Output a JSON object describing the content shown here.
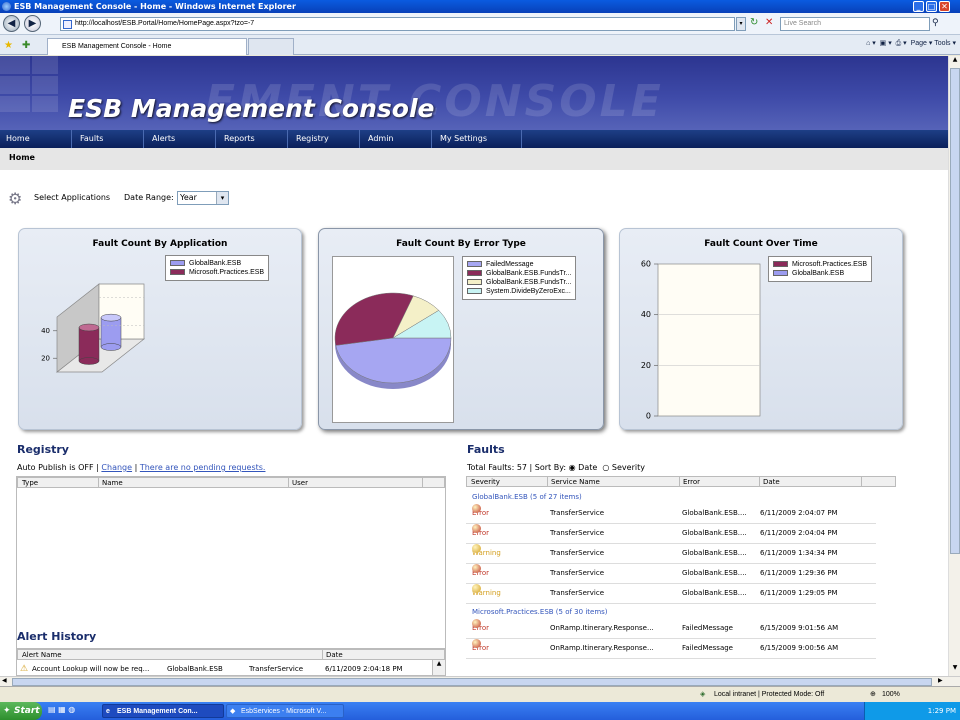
{
  "window": {
    "title": "ESB Management Console - Home - Windows Internet Explorer",
    "url": "http://localhost/ESB.Portal/Home/HomePage.aspx?tzo=-7",
    "search_placeholder": "Live Search",
    "tab_label": "ESB Management Console - Home",
    "commands": "Page ▾  Tools ▾"
  },
  "app": {
    "banner_title": "ESB Management Console",
    "banner_ghost": "EMENT CONSOLE",
    "menu": [
      "Home",
      "Faults",
      "Alerts",
      "Reports",
      "Registry",
      "Admin",
      "My Settings"
    ],
    "breadcrumb": "Home"
  },
  "filter": {
    "select_apps_label": "Select Applications",
    "date_range_label": "Date Range:",
    "date_range_value": "Year"
  },
  "panels": {
    "app": {
      "title": "Fault Count By Application",
      "legend": [
        "GlobalBank.ESB",
        "Microsoft.Practices.ESB"
      ]
    },
    "error": {
      "title": "Fault Count By Error Type",
      "legend": [
        "FailedMessage",
        "GlobalBank.ESB.FundsTr...",
        "GlobalBank.ESB.FundsTr...",
        "System.DivideByZeroExc..."
      ]
    },
    "time": {
      "title": "Fault Count Over Time",
      "legend": [
        "Microsoft.Practices.ESB",
        "GlobalBank.ESB"
      ]
    }
  },
  "chart_data": [
    {
      "type": "bar",
      "title": "Fault Count By Application",
      "categories": [
        ""
      ],
      "series": [
        {
          "name": "Microsoft.Practices.ESB",
          "values": [
            30
          ]
        },
        {
          "name": "GlobalBank.ESB",
          "values": [
            27
          ]
        }
      ],
      "yticks": [
        20,
        40
      ],
      "ylim": [
        10,
        50
      ],
      "colors": [
        "#8b2b5a",
        "#9c9cf0"
      ]
    },
    {
      "type": "pie",
      "title": "Fault Count By Error Type",
      "series": [
        {
          "name": "FailedMessage",
          "values": [
            27
          ]
        },
        {
          "name": "GlobalBank.ESB.FundsTr...",
          "values": [
            19
          ]
        },
        {
          "name": "GlobalBank.ESB.FundsTr...",
          "values": [
            5
          ]
        },
        {
          "name": "System.DivideByZeroExc...",
          "values": [
            6
          ]
        }
      ],
      "colors": [
        "#a6a6f2",
        "#8b2b5a",
        "#f4f0c8",
        "#c8f4f4"
      ]
    },
    {
      "type": "line",
      "title": "Fault Count Over Time",
      "series": [
        {
          "name": "Microsoft.Practices.ESB",
          "values": []
        },
        {
          "name": "GlobalBank.ESB",
          "values": []
        }
      ],
      "yticks": [
        0,
        20,
        40,
        60
      ],
      "ylim": [
        0,
        60
      ],
      "grid": true,
      "colors": [
        "#8b2b5a",
        "#9c9cf0"
      ]
    }
  ],
  "registry": {
    "heading": "Registry",
    "auto_publish": "Auto Publish is OFF |",
    "change_link": "Change",
    "sep": "|",
    "pending_link": "There are no pending requests.",
    "columns": [
      "Type",
      "Name",
      "User"
    ]
  },
  "alert_history": {
    "heading": "Alert History",
    "columns": [
      "Alert Name",
      "Date"
    ],
    "rows": [
      {
        "name": "Account Lookup will now be req...",
        "app": "GlobalBank.ESB",
        "service": "TransferService",
        "date": "6/11/2009 2:04:18 PM"
      }
    ]
  },
  "faults": {
    "heading": "Faults",
    "total_label": "Total Faults: 57 | Sort By:",
    "sort_date": "Date",
    "sort_severity": "Severity",
    "columns": [
      "Severity",
      "Service Name",
      "Error",
      "Date"
    ],
    "groups": [
      {
        "label": "GlobalBank.ESB  (5 of 27 items)",
        "rows": [
          {
            "severity": "Error",
            "service": "TransferService",
            "error": "GlobalBank.ESB....",
            "date": "6/11/2009 2:04:07 PM"
          },
          {
            "severity": "Error",
            "service": "TransferService",
            "error": "GlobalBank.ESB....",
            "date": "6/11/2009 2:04:04 PM"
          },
          {
            "severity": "Warning",
            "service": "TransferService",
            "error": "GlobalBank.ESB....",
            "date": "6/11/2009 1:34:34 PM"
          },
          {
            "severity": "Error",
            "service": "TransferService",
            "error": "GlobalBank.ESB....",
            "date": "6/11/2009 1:29:36 PM"
          },
          {
            "severity": "Warning",
            "service": "TransferService",
            "error": "GlobalBank.ESB....",
            "date": "6/11/2009 1:29:05 PM"
          }
        ]
      },
      {
        "label": "Microsoft.Practices.ESB  (5 of 30 items)",
        "rows": [
          {
            "severity": "Error",
            "service": "OnRamp.Itinerary.Response...",
            "error": "FailedMessage",
            "date": "6/15/2009 9:01:56 AM"
          },
          {
            "severity": "Error",
            "service": "OnRamp.Itinerary.Response...",
            "error": "FailedMessage",
            "date": "6/15/2009 9:00:56 AM"
          }
        ]
      }
    ]
  },
  "status": {
    "zone": "Local intranet | Protected Mode: Off",
    "zoom": "100%"
  },
  "taskbar": {
    "start": "Start",
    "tasks": [
      "ESB Management Con...",
      "EsbServices - Microsoft V..."
    ],
    "clock": "1:29 PM"
  },
  "colors": {
    "error": "#c0392b",
    "warning": "#d4a020",
    "link": "#3355bb",
    "heading": "#1a2d6b"
  }
}
